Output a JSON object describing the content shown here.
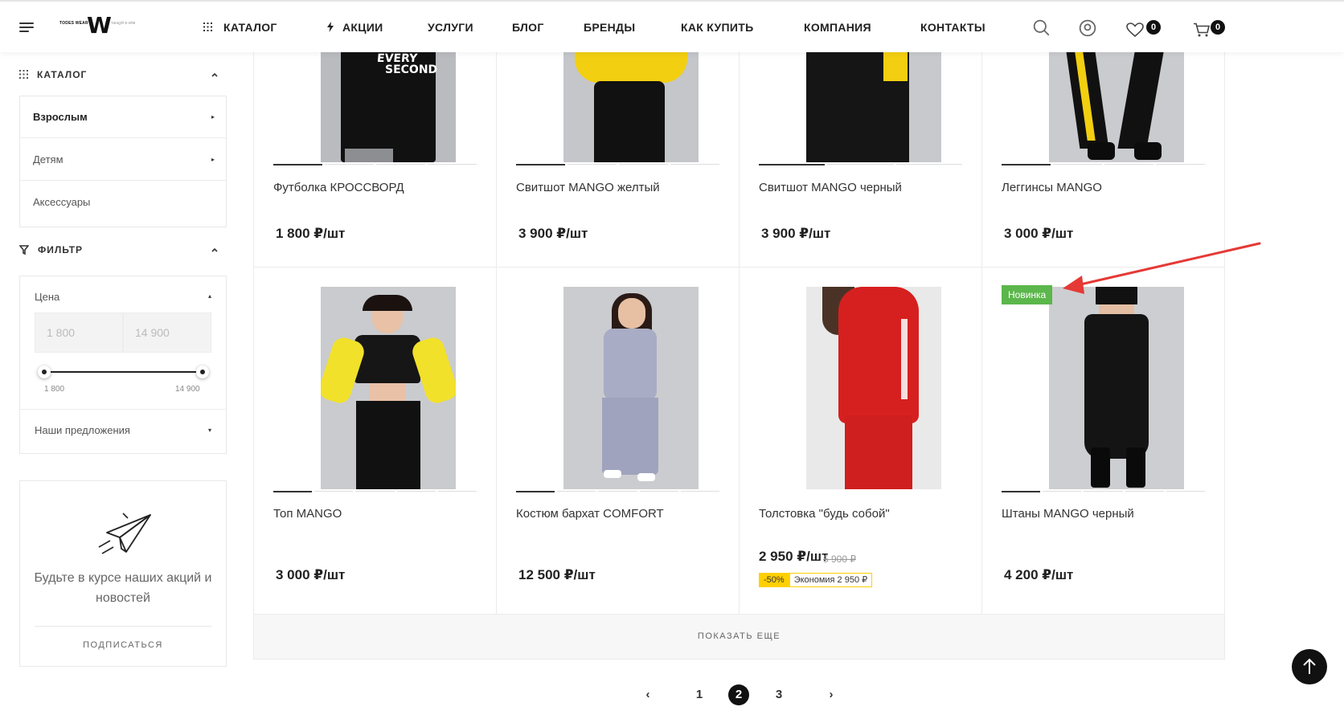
{
  "header": {
    "logo_small": "TODES WEAR",
    "logo_letter": "W",
    "logo_tag": "танцуй в нём",
    "nav": [
      {
        "label": "КАТАЛОГ",
        "icon": "grid-icon"
      },
      {
        "label": "АКЦИИ",
        "icon": "lightning-icon"
      },
      {
        "label": "УСЛУГИ"
      },
      {
        "label": "БЛОГ"
      },
      {
        "label": "БРЕНДЫ"
      },
      {
        "label": "КАК КУПИТЬ"
      },
      {
        "label": "КОМПАНИЯ"
      },
      {
        "label": "КОНТАКТЫ"
      }
    ],
    "favorites_count": "0",
    "cart_count": "0"
  },
  "sidebar": {
    "catalog_title": "КАТАЛОГ",
    "catalog_items": [
      {
        "label": "Взрослым"
      },
      {
        "label": "Детям"
      },
      {
        "label": "Аксессуары"
      }
    ],
    "filter_title": "ФИЛЬТР",
    "filter": {
      "price_label": "Цена",
      "price_min_placeholder": "1 800",
      "price_max_placeholder": "14 900",
      "slider_min": "1 800",
      "slider_max": "14 900",
      "offers_label": "Наши предложения"
    },
    "subscribe": {
      "text": "Будьте в курсе наших акций и новостей",
      "button": "ПОДПИСАТЬСЯ"
    }
  },
  "products": [
    {
      "name": "Футболка КРОССВОРД",
      "price": "1 800 ₽/шт",
      "shirt_text_1": "EVERY",
      "shirt_text_2": "SECOND"
    },
    {
      "name": "Свитшот MANGO желтый",
      "price": "3 900 ₽/шт"
    },
    {
      "name": "Свитшот MANGO черный",
      "price": "3 900 ₽/шт"
    },
    {
      "name": "Леггинсы MANGO",
      "price": "3 000 ₽/шт"
    },
    {
      "name": "Топ MANGO",
      "price": "3 000 ₽/шт"
    },
    {
      "name": "Костюм бархат COMFORT",
      "price": "12 500 ₽/шт"
    },
    {
      "name": "Толстовка \"будь собой\"",
      "price": "2 950 ₽/шт",
      "old_price": "5 900 ₽",
      "discount": "-50%",
      "savings": "Экономия 2 950 ₽"
    },
    {
      "name": "Штаны MANGO черный",
      "price": "4 200 ₽/шт",
      "badge": "Новинка"
    }
  ],
  "show_more": "ПОКАЗАТЬ ЕЩЕ",
  "pagination": {
    "prev": "‹",
    "pages": [
      "1",
      "2",
      "3"
    ],
    "current": "2",
    "next": "›"
  },
  "colors": {
    "accent": "#111111",
    "new_badge": "#5bb74b",
    "discount": "#ffd000",
    "annotation_arrow": "#e53935"
  }
}
